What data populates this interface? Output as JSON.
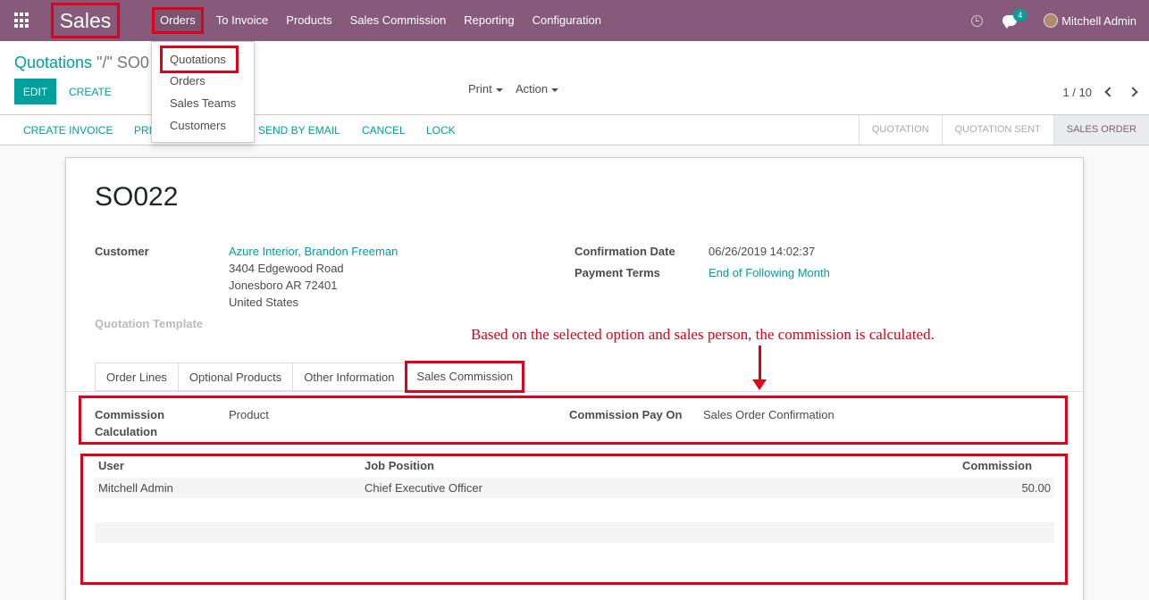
{
  "navbar": {
    "app_name": "Sales",
    "menu": [
      "Orders",
      "To Invoice",
      "Products",
      "Sales Commission",
      "Reporting",
      "Configuration"
    ],
    "chat_count": "4",
    "user": "Mitchell Admin"
  },
  "orders_menu": [
    "Quotations",
    "Orders",
    "Sales Teams",
    "Customers"
  ],
  "control_panel": {
    "breadcrumb_root": "Quotations",
    "breadcrumb_sep": "\"/\"",
    "breadcrumb_current": "SO0",
    "edit_label": "EDIT",
    "create_label": "CREATE",
    "print_label": "Print",
    "action_label": "Action",
    "pager": "1 / 10"
  },
  "statusbar": {
    "buttons": [
      "CREATE INVOICE",
      "PRI",
      "SEND BY EMAIL",
      "CANCEL",
      "LOCK"
    ],
    "stages": [
      "QUOTATION",
      "QUOTATION SENT",
      "SALES ORDER"
    ],
    "active_stage": "SALES ORDER"
  },
  "form": {
    "name": "SO022",
    "customer_label": "Customer",
    "customer_name": "Azure Interior, Brandon Freeman",
    "address_line1": "3404 Edgewood Road",
    "address_line2": "Jonesboro AR 72401",
    "address_country": "United States",
    "quotation_template_label": "Quotation Template",
    "confirmation_date_label": "Confirmation Date",
    "confirmation_date": "06/26/2019 14:02:37",
    "payment_terms_label": "Payment Terms",
    "payment_terms": "End of Following Month"
  },
  "annotation": "Based on the selected option and sales person,  the commission is calculated.",
  "tabs": [
    "Order Lines",
    "Optional Products",
    "Other Information",
    "Sales Commission"
  ],
  "active_tab": "Sales Commission",
  "commission": {
    "calc_label_line1": "Commission",
    "calc_label_line2": "Calculation",
    "calc_value": "Product",
    "pay_on_label": "Commission Pay On",
    "pay_on_value": "Sales Order Confirmation"
  },
  "commission_table": {
    "columns": [
      "User",
      "Job Position",
      "Commission"
    ],
    "rows": [
      [
        "Mitchell Admin",
        "Chief Executive Officer",
        "50.00"
      ]
    ]
  },
  "colors": {
    "brand": "#875a7b",
    "accent": "#00a09d",
    "highlight": "#e0001a"
  }
}
